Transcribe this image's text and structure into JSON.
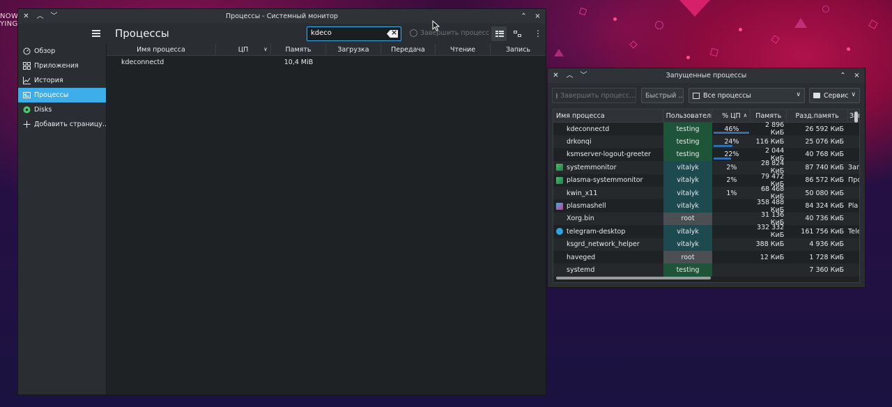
{
  "desktop": {
    "now_playing_line1": "NOW",
    "now_playing_line2": "YING"
  },
  "main_window": {
    "title": "Процессы - Системный монитор",
    "page_title": "Процессы",
    "search": {
      "value": "kdeco"
    },
    "kill_button_label": "Завершить процесс",
    "sidebar": [
      {
        "label": "Обзор",
        "icon": "speedometer-icon"
      },
      {
        "label": "Приложения",
        "icon": "grid-icon"
      },
      {
        "label": "История",
        "icon": "chart-icon"
      },
      {
        "label": "Процессы",
        "icon": "process-icon",
        "active": true
      },
      {
        "label": "Disks",
        "icon": "disk-icon"
      },
      {
        "label": "Добавить страницу...",
        "icon": "plus-icon"
      }
    ],
    "columns": [
      "Имя процесса",
      "ЦП",
      "Память",
      "Загрузка",
      "Передача",
      "Чтение",
      "Запись"
    ],
    "rows": [
      {
        "name": "kdeconnectd",
        "cpu": "",
        "memory": "10,4 MiB",
        "load": "",
        "transfer": "",
        "read": "",
        "write": ""
      }
    ]
  },
  "secondary_window": {
    "title": "Запущенные процессы",
    "kill_button_label": "Завершить процесс...",
    "quick_search_placeholder": "Быстрый ...",
    "filter_value": "Все процессы",
    "tools_label": "Сервис",
    "columns": [
      "Имя процесса",
      "Пользователь",
      "% ЦП",
      "Память",
      "Разд.память",
      "Зап"
    ],
    "rows": [
      {
        "name": "kdeconnectd",
        "user": "testing",
        "cpu": "46%",
        "cpu_level": 0.46,
        "memory": "2 896 КиБ",
        "shared": "26 592 КиБ",
        "extra": "",
        "icon": "none"
      },
      {
        "name": "drkonqi",
        "user": "testing",
        "cpu": "24%",
        "cpu_level": 0.24,
        "memory": "116 КиБ",
        "shared": "25 076 КиБ",
        "extra": "",
        "icon": "none"
      },
      {
        "name": "ksmserver-logout-greeter",
        "user": "testing",
        "cpu": "22%",
        "cpu_level": 0.22,
        "memory": "2 044 КиБ",
        "shared": "40 768 КиБ",
        "extra": "",
        "icon": "none"
      },
      {
        "name": "systemmonitor",
        "user": "vitalyk",
        "cpu": "2%",
        "cpu_level": 0.02,
        "memory": "28 824 КиБ",
        "shared": "87 740 КиБ",
        "extra": "Зап",
        "icon": "monitor-app-icon"
      },
      {
        "name": "plasma-systemmonitor",
        "user": "vitalyk",
        "cpu": "2%",
        "cpu_level": 0.02,
        "memory": "79 472 КиБ",
        "shared": "86 572 КиБ",
        "extra": "Про",
        "icon": "monitor-app-icon"
      },
      {
        "name": "kwin_x11",
        "user": "vitalyk",
        "cpu": "1%",
        "cpu_level": 0.01,
        "memory": "68 468 КиБ",
        "shared": "50 080 КиБ",
        "extra": "",
        "icon": "none"
      },
      {
        "name": "plasmashell",
        "user": "vitalyk",
        "cpu": "",
        "cpu_level": 0,
        "memory": "358 488 КиБ",
        "shared": "84 324 КиБ",
        "extra": "Pla",
        "icon": "plasma-app-icon"
      },
      {
        "name": "Xorg.bin",
        "user": "root",
        "cpu": "",
        "cpu_level": 0,
        "memory": "31 136 КиБ",
        "shared": "40 736 КиБ",
        "extra": "",
        "icon": "none"
      },
      {
        "name": "telegram-desktop",
        "user": "vitalyk",
        "cpu": "",
        "cpu_level": 0,
        "memory": "332 332 КиБ",
        "shared": "161 756 КиБ",
        "extra": "Tele",
        "icon": "telegram-icon"
      },
      {
        "name": "ksgrd_network_helper",
        "user": "vitalyk",
        "cpu": "",
        "cpu_level": 0,
        "memory": "388 КиБ",
        "shared": "4 936 КиБ",
        "extra": "",
        "icon": "none"
      },
      {
        "name": "haveged",
        "user": "root",
        "cpu": "",
        "cpu_level": 0,
        "memory": "12 КиБ",
        "shared": "1 728 КиБ",
        "extra": "",
        "icon": "none"
      },
      {
        "name": "systemd",
        "user": "testing",
        "cpu": "",
        "cpu_level": 0,
        "memory": "",
        "shared": "7 360 КиБ",
        "extra": "",
        "icon": "none"
      }
    ]
  },
  "colors": {
    "accent": "#3daee9",
    "user_testing": "#1e5538",
    "user_vitalyk": "#1d4a4f",
    "user_root": "#4b4f52",
    "cpu_bar": "#2f6fb0"
  }
}
